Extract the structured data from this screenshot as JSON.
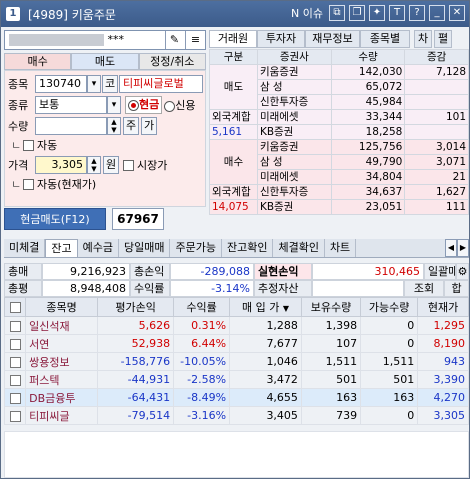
{
  "title": {
    "code": "[4989]",
    "name": "키움주문",
    "num": "1",
    "issue_label": "N 이슈"
  },
  "account": {
    "suffix": "***"
  },
  "order_tabs": [
    "매수",
    "매도",
    "정정/취소"
  ],
  "form": {
    "code_label": "종목",
    "code_value": "130740",
    "code_btn": "코",
    "stock_name": "티피씨글로벌",
    "type_label": "종류",
    "type_value": "보통",
    "cash": "현금",
    "credit": "신용",
    "qty_label": "수량",
    "qty_btn1": "주",
    "qty_btn2": "가",
    "auto_label": "자동",
    "price_label": "가격",
    "price_value": "3,305",
    "price_unit": "원",
    "market_label": "시장가",
    "auto_cur_label": "자동(현재가)"
  },
  "submit": {
    "label": "현금매도(F12)",
    "qty": "67967"
  },
  "broker_tabs": [
    "거래원",
    "투자자",
    "재무정보",
    "종목별",
    "차",
    "펼"
  ],
  "broker_head": [
    "구분",
    "증권사",
    "수량",
    "증감"
  ],
  "sell": {
    "label": "매도",
    "rows": [
      {
        "name": "키움증권",
        "qty": "142,030",
        "chg": "7,128"
      },
      {
        "name": "삼    성",
        "qty": "65,072",
        "chg": ""
      },
      {
        "name": "신한투자증",
        "qty": "45,984",
        "chg": ""
      },
      {
        "name": "미래에셋",
        "qty": "33,344",
        "chg": "101"
      },
      {
        "name": "KB증권",
        "qty": "18,258",
        "chg": ""
      }
    ],
    "foreign_label": "외국계합",
    "foreign_val": "5,161"
  },
  "buy": {
    "label": "매수",
    "rows": [
      {
        "name": "키움증권",
        "qty": "125,756",
        "chg": "3,014"
      },
      {
        "name": "삼    성",
        "qty": "49,790",
        "chg": "3,071"
      },
      {
        "name": "미래에셋",
        "qty": "34,804",
        "chg": "21"
      },
      {
        "name": "신한투자증",
        "qty": "34,637",
        "chg": "1,627"
      },
      {
        "name": "KB증권",
        "qty": "23,051",
        "chg": "111"
      }
    ],
    "foreign_label": "외국계합",
    "foreign_val": "14,075"
  },
  "bottom_tabs": [
    "미체결",
    "잔고",
    "예수금",
    "당일매매",
    "주문가능",
    "잔고확인",
    "체결확인",
    "차트"
  ],
  "summary": {
    "buy_total_label": "총매입",
    "buy_total": "9,216,923",
    "pl_label": "총손익",
    "pl": "-289,088",
    "realized_label": "실현손익",
    "realized": "310,465",
    "daily_label": "일괄매도",
    "eval_label": "총평가",
    "eval": "8,948,408",
    "rate_label": "수익률",
    "rate": "-3.14%",
    "est_label": "추정자산",
    "query": "조회",
    "sum_btn": "합"
  },
  "grid": {
    "headers": [
      "종목명",
      "평가손익",
      "수익률",
      "매 입 가",
      "보유수량",
      "가능수량",
      "현재가"
    ],
    "rows": [
      {
        "name": "일신석재",
        "pl": "5,626",
        "rate": "0.31%",
        "buy": "1,288",
        "hold": "1,398",
        "avail": "0",
        "cur": "1,295",
        "dir": "up"
      },
      {
        "name": "서연",
        "pl": "52,938",
        "rate": "6.44%",
        "buy": "7,677",
        "hold": "107",
        "avail": "0",
        "cur": "8,190",
        "dir": "up"
      },
      {
        "name": "쌍용정보",
        "pl": "-158,776",
        "rate": "-10.05%",
        "buy": "1,046",
        "hold": "1,511",
        "avail": "1,511",
        "cur": "943",
        "dir": "down"
      },
      {
        "name": "퍼스텍",
        "pl": "-44,931",
        "rate": "-2.58%",
        "buy": "3,472",
        "hold": "501",
        "avail": "501",
        "cur": "3,390",
        "dir": "down"
      },
      {
        "name": "DB금융투",
        "pl": "-64,431",
        "rate": "-8.49%",
        "buy": "4,655",
        "hold": "163",
        "avail": "163",
        "cur": "4,270",
        "dir": "down"
      },
      {
        "name": "티피씨글",
        "pl": "-79,514",
        "rate": "-3.16%",
        "buy": "3,405",
        "hold": "739",
        "avail": "0",
        "cur": "3,305",
        "dir": "down"
      }
    ]
  },
  "colors": {
    "up": "#d10000",
    "down": "#1a36c7",
    "accent": "#3f6fb6"
  }
}
